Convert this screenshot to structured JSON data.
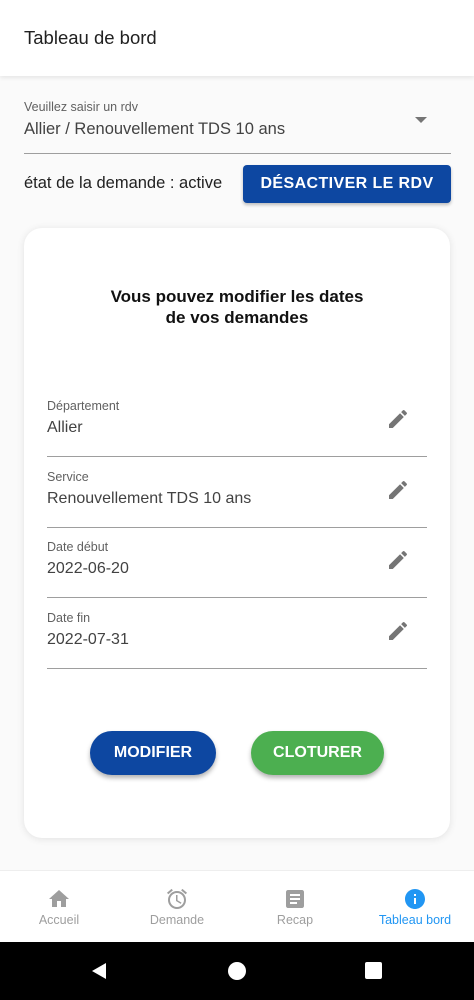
{
  "app_bar": {
    "title": "Tableau de bord"
  },
  "rdv_select": {
    "label": "Veuillez saisir un rdv",
    "value": "Allier / Renouvellement TDS 10 ans"
  },
  "status": {
    "text": "état de la demande : active",
    "deactivate_label": "DÉSACTIVER LE RDV"
  },
  "card": {
    "title_line1": "Vous pouvez modifier les dates",
    "title_line2": "de vos demandes",
    "fields": [
      {
        "label": "Département",
        "value": "Allier"
      },
      {
        "label": "Service",
        "value": "Renouvellement TDS 10 ans"
      },
      {
        "label": "Date début",
        "value": "2022-06-20"
      },
      {
        "label": "Date fin",
        "value": "2022-07-31"
      }
    ],
    "modify_label": "MODIFIER",
    "close_label": "CLOTURER"
  },
  "bottom_nav": {
    "items": [
      {
        "label": "Accueil",
        "icon": "home-icon"
      },
      {
        "label": "Demande",
        "icon": "alarm-clock-icon"
      },
      {
        "label": "Recap",
        "icon": "document-icon"
      },
      {
        "label": "Tableau bord",
        "icon": "info-icon"
      }
    ],
    "active_index": 3
  },
  "colors": {
    "primary": "#0d47a1",
    "success": "#4caf50",
    "nav_active": "#2196f3",
    "nav_inactive": "#9e9e9e"
  }
}
